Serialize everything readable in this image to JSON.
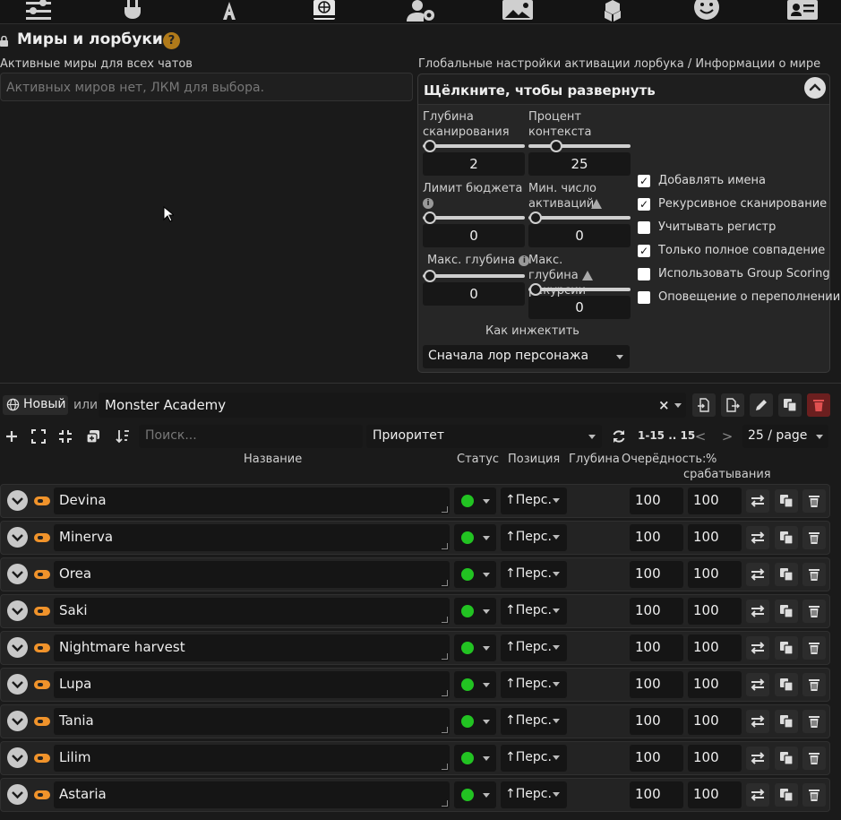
{
  "topbar": {
    "icons": [
      "sliders-icon",
      "plug-icon",
      "font-icon",
      "book-globe-icon",
      "user-gear-icon",
      "image-icon",
      "cubes-icon",
      "smile-icon",
      "id-card-icon"
    ]
  },
  "header": {
    "title": "Миры и лорбуки",
    "help": "?"
  },
  "active_worlds": {
    "label": "Активные миры для всех чатов",
    "placeholder": "Активных миров нет, ЛКМ для выбора."
  },
  "global": {
    "label": "Глобальные настройки активации лорбука / Информации о мире",
    "drawer_title": "Щёлкните, чтобы развернуть",
    "settings": [
      {
        "label": "Глубина сканирования",
        "value": "2"
      },
      {
        "label": "Процент контекста",
        "value": "25"
      },
      {
        "label": "Лимит бюджета",
        "value": "0"
      },
      {
        "label": "Мин. число активаций",
        "value": "0"
      },
      {
        "label": "Макс. глубина",
        "value": "0"
      },
      {
        "label": "Макс. глубина рекурсии",
        "value": "0"
      }
    ],
    "checkboxes": [
      {
        "label": "Добавлять имена",
        "checked": true
      },
      {
        "label": "Рекурсивное сканирование",
        "checked": true
      },
      {
        "label": "Учитывать регистр",
        "checked": false
      },
      {
        "label": "Только полное совпадение",
        "checked": true
      },
      {
        "label": "Использовать Group Scoring",
        "checked": false
      },
      {
        "label": "Оповещение о переполнении",
        "checked": false
      }
    ],
    "insertion_label": "Как инжектить",
    "insertion_value": "Сначала лор персонажа"
  },
  "editor": {
    "new_label": "Новый",
    "or_label": "или",
    "world_name": "Monster Academy",
    "clear": "×",
    "search_placeholder": "Поиск...",
    "sort_value": "Приоритет",
    "page_info": "1-15 .. 15",
    "prev": "<",
    "next": ">",
    "per_page": "25 / page"
  },
  "columns": {
    "name": "Название",
    "status": "Статус",
    "position": "Позиция",
    "depth": "Глубина",
    "order": "Очерёдность:",
    "percent": "%",
    "percent2": "срабатывания"
  },
  "entries": [
    {
      "name": "Devina",
      "position": "↑Перс.",
      "order": "100",
      "percent": "100"
    },
    {
      "name": "Minerva",
      "position": "↑Перс.",
      "order": "100",
      "percent": "100"
    },
    {
      "name": "Orea",
      "position": "↑Перс.",
      "order": "100",
      "percent": "100"
    },
    {
      "name": "Saki",
      "position": "↑Перс.",
      "order": "100",
      "percent": "100"
    },
    {
      "name": "Nightmare harvest",
      "position": "↑Перс.",
      "order": "100",
      "percent": "100"
    },
    {
      "name": "Lupa",
      "position": "↑Перс.",
      "order": "100",
      "percent": "100"
    },
    {
      "name": "Tania",
      "position": "↑Перс.",
      "order": "100",
      "percent": "100"
    },
    {
      "name": "Lilim",
      "position": "↑Перс.",
      "order": "100",
      "percent": "100"
    },
    {
      "name": "Astaria",
      "position": "↑Перс.",
      "order": "100",
      "percent": "100"
    }
  ],
  "colors": {
    "accent": "#f0932b",
    "status_green": "#22c322",
    "background": "#1a1a1a",
    "help": "#b07a1a"
  }
}
